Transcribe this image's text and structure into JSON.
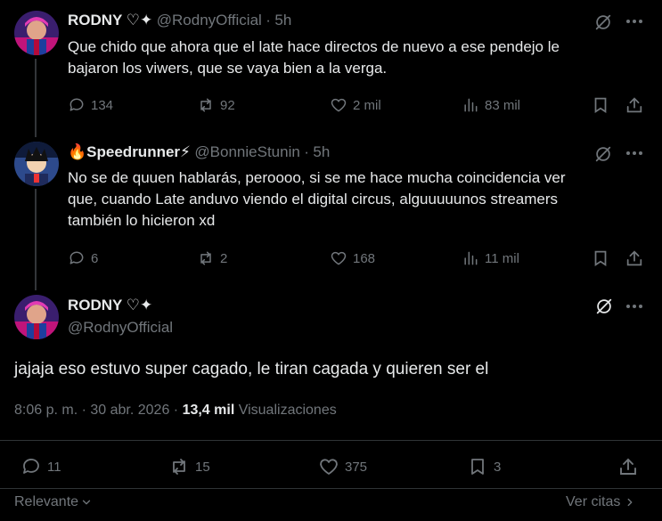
{
  "tweets": [
    {
      "name": "RODNY ♡✦",
      "handle": "@RodnyOfficial",
      "sep": "·",
      "time": "5h",
      "text_lines": [
        "Que chido que ahora que el late hace directos de nuevo a ese pendejo le",
        "bajaron los viwers, que se vaya bien a la verga."
      ],
      "replies": "134",
      "reposts": "92",
      "likes": "2 mil",
      "views": "83 mil"
    },
    {
      "name_prefix": "🔥",
      "name": "Speedrunner",
      "name_suffix": "⚡",
      "handle": "@BonnieStunin",
      "sep": "·",
      "time": "5h",
      "text_lines": [
        "No se de quuen hablarás, peroooo, si se me hace mucha coincidencia ver",
        "que, cuando Late anduvo viendo el digital circus, alguuuuunos streamers",
        "también lo hicieron xd"
      ],
      "replies": "6",
      "reposts": "2",
      "likes": "168",
      "views": "11 mil"
    }
  ],
  "main": {
    "name": "RODNY ♡✦",
    "handle": "@RodnyOfficial",
    "text": "jajaja eso estuvo super cagado, le tiran cagada y quieren ser el",
    "time": "8:06 p. m. · 30 abr. 2026 ·",
    "views_count": "13,4 mil",
    "views_label": "Visualizaciones",
    "replies": "11",
    "reposts": "15",
    "likes": "375",
    "bookmarks": "3"
  },
  "footer": {
    "sort_label": "Relevante",
    "quotes_label": "Ver citas"
  }
}
